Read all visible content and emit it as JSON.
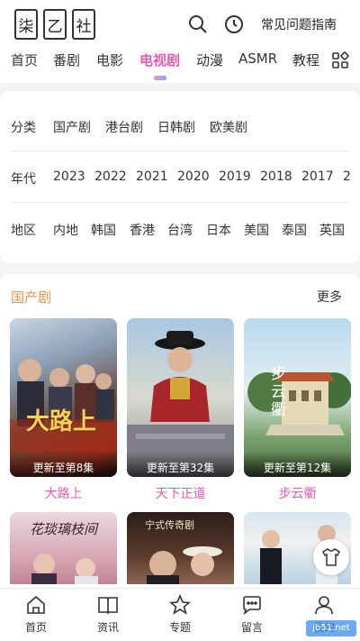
{
  "header": {
    "logo_chars": [
      "柒",
      "乙",
      "社"
    ],
    "faq_label": "常见问题指南"
  },
  "nav": {
    "tabs": [
      "首页",
      "番剧",
      "电影",
      "电视剧",
      "动漫",
      "ASMR",
      "教程"
    ],
    "active": "电视剧"
  },
  "filters": {
    "category": {
      "label": "分类",
      "options": [
        "国产剧",
        "港台剧",
        "日韩剧",
        "欧美剧"
      ]
    },
    "year": {
      "label": "年代",
      "options": [
        "2023",
        "2022",
        "2021",
        "2020",
        "2019",
        "2018",
        "2017",
        "2"
      ]
    },
    "region": {
      "label": "地区",
      "options": [
        "内地",
        "韩国",
        "香港",
        "台湾",
        "日本",
        "美国",
        "泰国",
        "英国"
      ]
    }
  },
  "section": {
    "title": "国产剧",
    "more_label": "更多",
    "items": [
      {
        "title": "大路上",
        "update": "更新至第8集",
        "poster_text": "大路上"
      },
      {
        "title": "天下正道",
        "update": "更新至第32集"
      },
      {
        "title": "步云衢",
        "update": "更新至第12集",
        "poster_text": "步云衢"
      }
    ],
    "row2_poster_texts": [
      "花琰璃枝间",
      "宁式传奇剧"
    ]
  },
  "tabbar": {
    "items": [
      "首页",
      "资讯",
      "专题",
      "留言",
      "我的"
    ]
  },
  "watermark": "jb51.net"
}
